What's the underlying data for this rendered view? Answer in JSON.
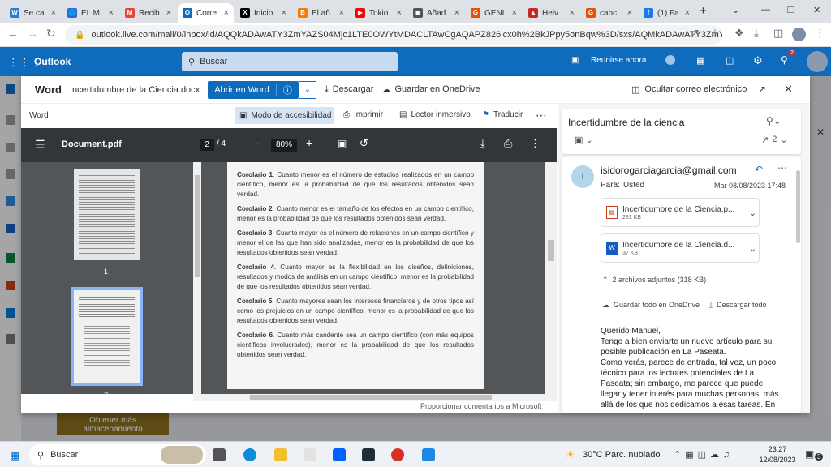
{
  "browser": {
    "tabs": [
      {
        "label": "Se ca",
        "color": "#2a7bd4",
        "glyph": "W"
      },
      {
        "label": "EL M",
        "color": "#3367d6",
        "glyph": "🌐"
      },
      {
        "label": "Recib",
        "color": "#ea4335",
        "glyph": "M"
      },
      {
        "label": "Corre",
        "color": "#0f6cbd",
        "glyph": "O"
      },
      {
        "label": "Inicio",
        "color": "#000000",
        "glyph": "X"
      },
      {
        "label": "El añ",
        "color": "#f57c00",
        "glyph": "B"
      },
      {
        "label": "Tokio",
        "color": "#ff0000",
        "glyph": "▶"
      },
      {
        "label": "Añad",
        "color": "#555555",
        "glyph": "▣"
      },
      {
        "label": "GENI",
        "color": "#e65100",
        "glyph": "G"
      },
      {
        "label": "Helv",
        "color": "#c62828",
        "glyph": "▲"
      },
      {
        "label": "cabc",
        "color": "#e65100",
        "glyph": "G"
      },
      {
        "label": "(1) Fa",
        "color": "#1877f2",
        "glyph": "f"
      }
    ],
    "url": "outlook.live.com/mail/0/inbox/id/AQQkADAwATY3ZmYAZS04Mjc1LTE0OWYtMDACLTAwCgAQAPZ826icx0h%2BkJPpy5onBqw%3D/sxs/AQMkADAwATY3ZmYA..."
  },
  "outlook": {
    "app_name": "Outlook",
    "search_placeholder": "Buscar",
    "meet_now": "Reunirse ahora",
    "notif_count": "2"
  },
  "viewer": {
    "app_label": "Word",
    "file_name": "Incertidumbre de la Ciencia.docx",
    "open_in_word": "Abrir en Word",
    "download": "Descargar",
    "save_onedrive": "Guardar en OneDrive",
    "hide_mail": "Ocultar correo electrónico",
    "toolbar": {
      "word": "Word",
      "accessibility": "Modo de accesibilidad",
      "print": "Imprimir",
      "reader": "Lector inmersivo",
      "translate": "Traducir"
    },
    "pdf": {
      "title": "Document.pdf",
      "page_current": "2",
      "page_total": "/  4",
      "zoom": "80%"
    },
    "thumb_labels": [
      "1",
      "2"
    ],
    "page_paragraphs": [
      {
        "bold": "Corolario 1",
        "text": ". Cuanto menor es el número de estudios realizados en un campo científico, menor es la probabilidad de que los resultados obtenidos sean verdad."
      },
      {
        "bold": "Corolario 2",
        "text": ". Cuanto menor es el tamaño de los efectos en un campo científico, menor es la probabilidad de que los resultados obtenidos sean verdad."
      },
      {
        "bold": "Corolario 3",
        "text": ". Cuanto mayor es el número de relaciones en un campo científico y menor el de las que han sido analizadas, menor es la probabilidad de que los resultados obtenidos sean verdad."
      },
      {
        "bold": "Corolario 4",
        "text": ". Cuanto mayor es la flexibilidad en los diseños, definiciones, resultados y modos de análisis en un campo científico, menor es la probabilidad de que los resultados obtenidos sean verdad."
      },
      {
        "bold": "Corolario 5",
        "text": ". Cuanto mayores sean los intereses financieros y de otros tipos así como los prejuicios en un campo científico, menor es la probabilidad de que los resultados obtenidos sean verdad."
      },
      {
        "bold": "Corolario 6",
        "text": ". Cuanto más candente sea un campo científico (con más equipos científicos involucrados), menor es la probabilidad de que los resultados obtenidos sean verdad."
      }
    ],
    "feedback": "Proporcionar comentarios a Microsoft"
  },
  "mail": {
    "subject": "Incertidumbre de la ciencia",
    "attach_count_icon": "2",
    "avatar_initial": "I",
    "sender": "isidorogarciagarcia@gmail.com",
    "to_label": "Para:",
    "to_value": "Usted",
    "date": "Mar 08/08/2023 17:48",
    "attachments": [
      {
        "name": "Incertidumbre de la Ciencia.p...",
        "size": "281 KB",
        "kind": "pdf"
      },
      {
        "name": "Incertidumbre de la Ciencia.d...",
        "size": "37 KB",
        "kind": "docx"
      }
    ],
    "attachments_summary": "2 archivos adjuntos (318 KB)",
    "save_all": "Guardar todo en OneDrive",
    "download_all": "Descargar todo",
    "body": [
      "Querido Manuel,",
      "Tengo a bien enviarte un nuevo artículo para su posible publicación en La Paseata.",
      "Como verás, parece de entrada, tal vez, un poco técnico para los lectores potenciales de La Paseata; sin embargo, me parece que puede llegar y tener interés para muchas personas, más allá de los que nos dedicamos a esas tareas. En"
    ]
  },
  "behind": {
    "storage_button": "Obtener más almacenamiento"
  },
  "taskbar": {
    "search": "Buscar",
    "weather": "30°C  Parc. nublado",
    "time": "23:27",
    "date": "12/08/2023",
    "notif": "3"
  }
}
